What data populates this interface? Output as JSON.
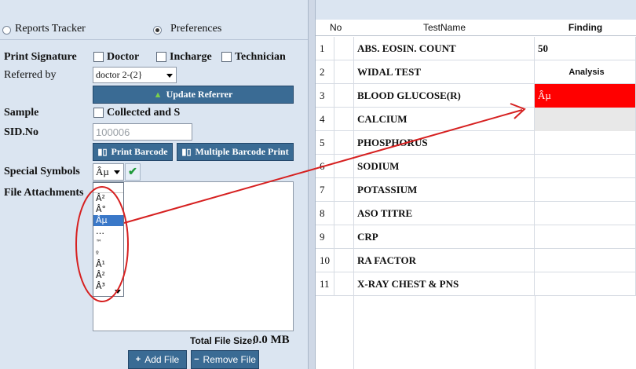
{
  "tabs": [
    {
      "label": "Reports Tracker",
      "selected": false
    },
    {
      "label": "Preferences",
      "selected": true
    }
  ],
  "print_signature": {
    "label": "Print Signature",
    "options": [
      "Doctor",
      "Incharge",
      "Technician"
    ]
  },
  "referred_by": {
    "label": "Referred by",
    "value": "doctor 2-(2}"
  },
  "update_referrer": {
    "label": "Update Referrer"
  },
  "sample": {
    "label": "Sample",
    "checkbox": "Collected and S"
  },
  "sid": {
    "label": "SID.No",
    "placeholder": "100006"
  },
  "print_barcode": {
    "label": "Print Barcode"
  },
  "multi_barcode": {
    "label": "Multiple Barcode Print"
  },
  "special_symbols": {
    "label": "Special Symbols",
    "value": "Âµ",
    "options": [
      "Â²",
      "Â°",
      "Âµ",
      "…",
      "™",
      "º",
      "Â¹",
      "Â²",
      "Â³"
    ],
    "selected_index": 2
  },
  "file_attachments": {
    "label": "File Attachments"
  },
  "total_file_size": {
    "label": "Total File Size:",
    "value": "0.0 MB"
  },
  "add_file": {
    "label": "Add File"
  },
  "remove_file": {
    "label": "Remove File"
  },
  "grid": {
    "headers": {
      "no": "No",
      "name": "TestName",
      "finding": "Finding"
    },
    "rows": [
      {
        "no": "1",
        "name": "ABS. EOSIN. COUNT",
        "finding": "50"
      },
      {
        "no": "2",
        "name": "WIDAL TEST",
        "finding": "Analysis"
      },
      {
        "no": "3",
        "name": "BLOOD GLUCOSE(R)",
        "finding": "Âµ"
      },
      {
        "no": "4",
        "name": "CALCIUM",
        "finding": ""
      },
      {
        "no": "5",
        "name": "PHOSPHORUS",
        "finding": ""
      },
      {
        "no": "6",
        "name": "SODIUM",
        "finding": ""
      },
      {
        "no": "7",
        "name": "POTASSIUM",
        "finding": ""
      },
      {
        "no": "8",
        "name": "ASO TITRE",
        "finding": ""
      },
      {
        "no": "9",
        "name": "CRP",
        "finding": ""
      },
      {
        "no": "10",
        "name": "RA FACTOR",
        "finding": ""
      },
      {
        "no": "11",
        "name": "X-RAY CHEST & PNS",
        "finding": ""
      }
    ]
  },
  "colors": {
    "accent_button": "#3a6b94",
    "highlight_cell": "#ff0000",
    "annotation": "#d62020"
  }
}
